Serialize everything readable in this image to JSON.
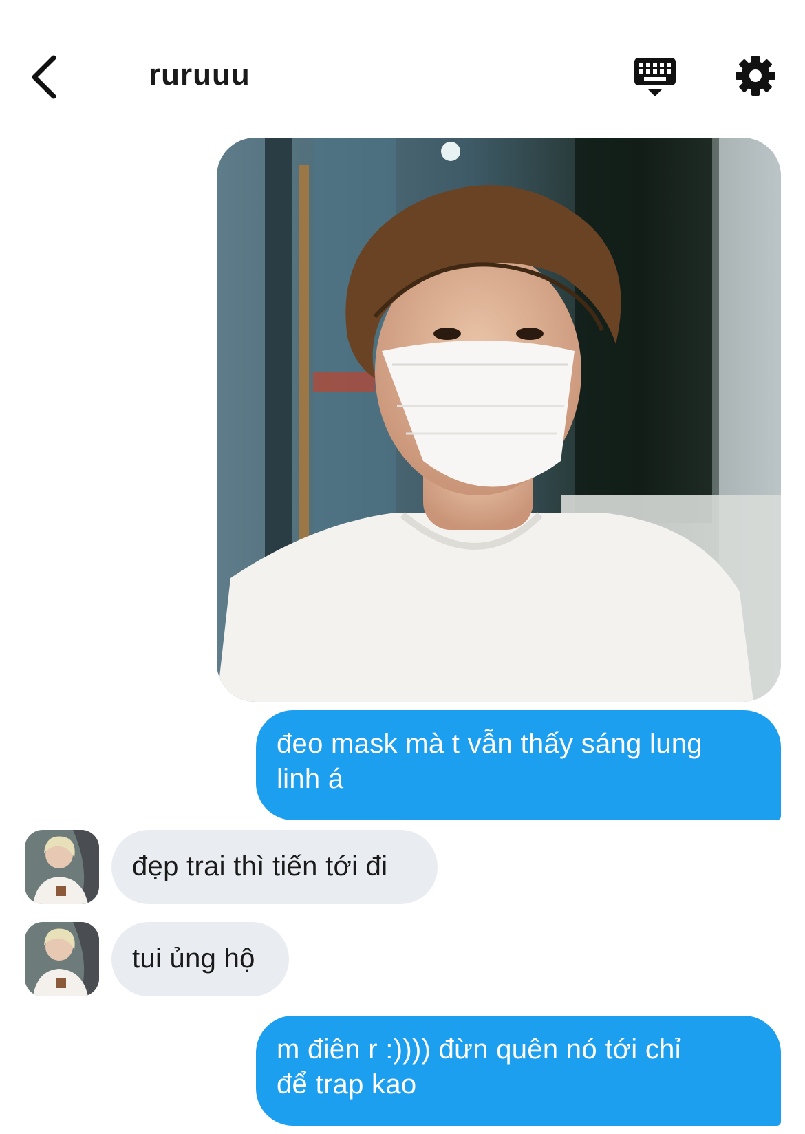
{
  "header": {
    "title": "ruruuu",
    "back_icon": "chevron-left-icon",
    "keyboard_icon": "keyboard-icon",
    "settings_icon": "gear-icon"
  },
  "colors": {
    "outgoing_bubble": "#1d9ff0",
    "incoming_bubble": "#e9edf2"
  },
  "messages": [
    {
      "sender": "me",
      "type": "image"
    },
    {
      "sender": "me",
      "type": "text",
      "text": "đeo mask mà t vẫn thấy sáng lung\nlinh á"
    },
    {
      "sender": "other",
      "type": "text",
      "text": "đẹp trai thì tiến tới đi"
    },
    {
      "sender": "other",
      "type": "text",
      "text": "tui ủng hộ"
    },
    {
      "sender": "me",
      "type": "text",
      "text": "m điên r :)))) đừn quên nó tới chỉ\nđể trap kao"
    }
  ]
}
